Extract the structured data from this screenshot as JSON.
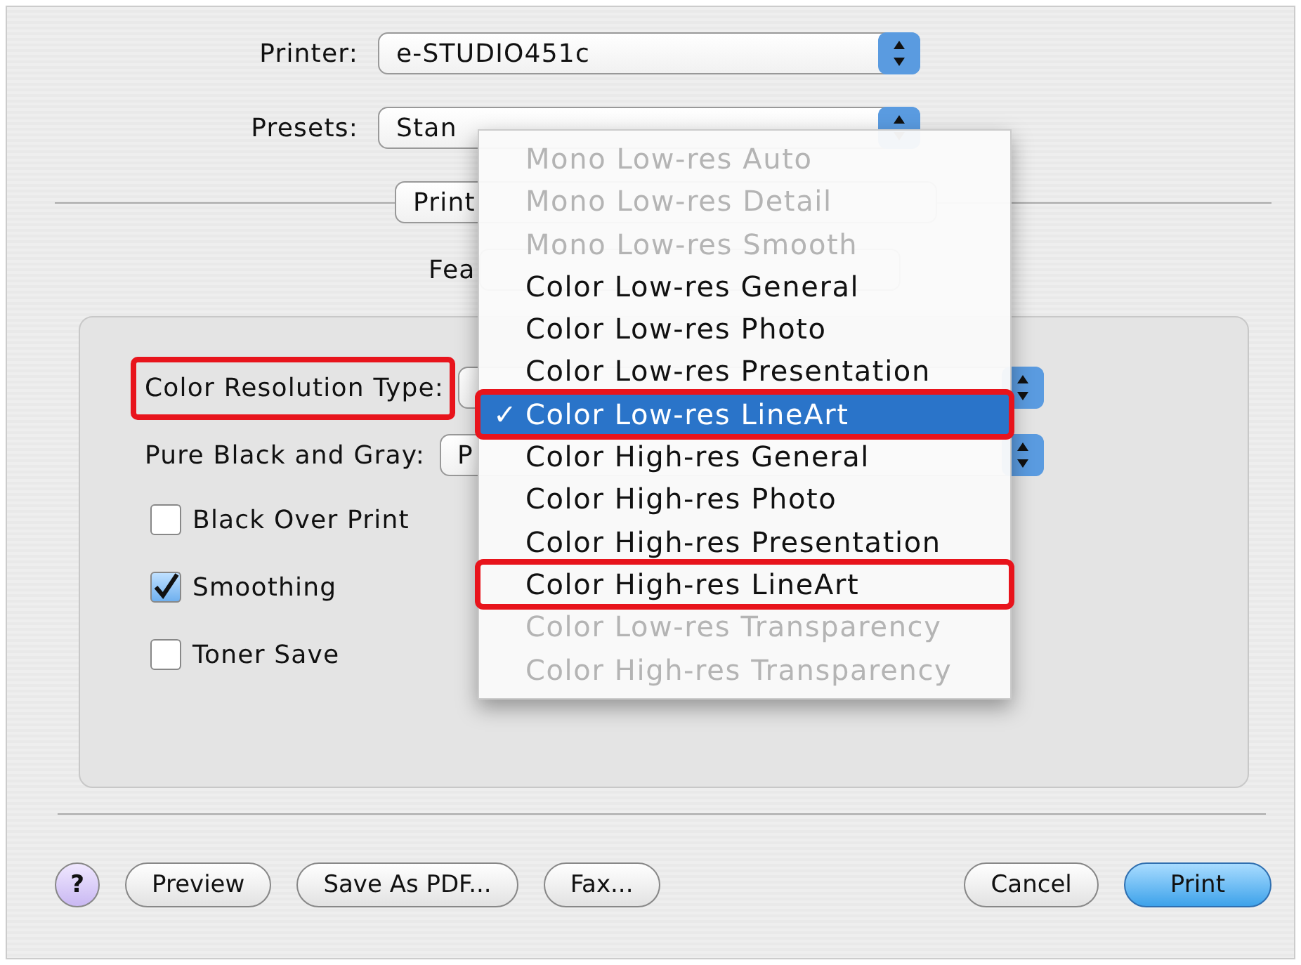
{
  "printer": {
    "label": "Printer:",
    "value": "e-STUDIO451c"
  },
  "presets": {
    "label": "Presets:",
    "value": "Stan"
  },
  "panel_popup": {
    "value": "Print"
  },
  "features": {
    "label": "Fea"
  },
  "settings": [
    {
      "kind": "popup",
      "label": "Color Resolution Type:",
      "highlighted": true
    },
    {
      "kind": "popup",
      "label": "Pure Black and Gray:",
      "value": "P",
      "highlighted": false
    },
    {
      "kind": "checkbox",
      "label": "Black Over Print",
      "checked": false
    },
    {
      "kind": "checkbox",
      "label": "Smoothing",
      "checked": true
    },
    {
      "kind": "checkbox",
      "label": "Toner Save",
      "checked": false
    }
  ],
  "menu": {
    "check": "✓",
    "items": [
      {
        "label": "Mono Low-res Auto",
        "disabled": true,
        "selected": false,
        "highlighted": false
      },
      {
        "label": "Mono Low-res Detail",
        "disabled": true,
        "selected": false,
        "highlighted": false
      },
      {
        "label": "Mono Low-res Smooth",
        "disabled": true,
        "selected": false,
        "highlighted": false
      },
      {
        "label": "Color Low-res General",
        "disabled": false,
        "selected": false,
        "highlighted": false
      },
      {
        "label": "Color Low-res Photo",
        "disabled": false,
        "selected": false,
        "highlighted": false
      },
      {
        "label": "Color Low-res Presentation",
        "disabled": false,
        "selected": false,
        "highlighted": false
      },
      {
        "label": "Color Low-res LineArt",
        "disabled": false,
        "selected": true,
        "highlighted": true
      },
      {
        "label": "Color High-res General",
        "disabled": false,
        "selected": false,
        "highlighted": false
      },
      {
        "label": "Color High-res Photo",
        "disabled": false,
        "selected": false,
        "highlighted": false
      },
      {
        "label": "Color High-res Presentation",
        "disabled": false,
        "selected": false,
        "highlighted": false
      },
      {
        "label": "Color High-res LineArt",
        "disabled": false,
        "selected": false,
        "highlighted": true
      },
      {
        "label": "Color Low-res Transparency",
        "disabled": true,
        "selected": false,
        "highlighted": false
      },
      {
        "label": "Color High-res Transparency",
        "disabled": true,
        "selected": false,
        "highlighted": false
      }
    ]
  },
  "buttons_left": [
    {
      "kind": "help",
      "label": "?"
    },
    {
      "kind": "normal",
      "label": "Preview"
    },
    {
      "kind": "normal",
      "label": "Save As PDF..."
    },
    {
      "kind": "normal",
      "label": "Fax..."
    }
  ],
  "buttons_right": [
    {
      "kind": "normal",
      "label": "Cancel"
    },
    {
      "kind": "default",
      "label": "Print"
    }
  ]
}
